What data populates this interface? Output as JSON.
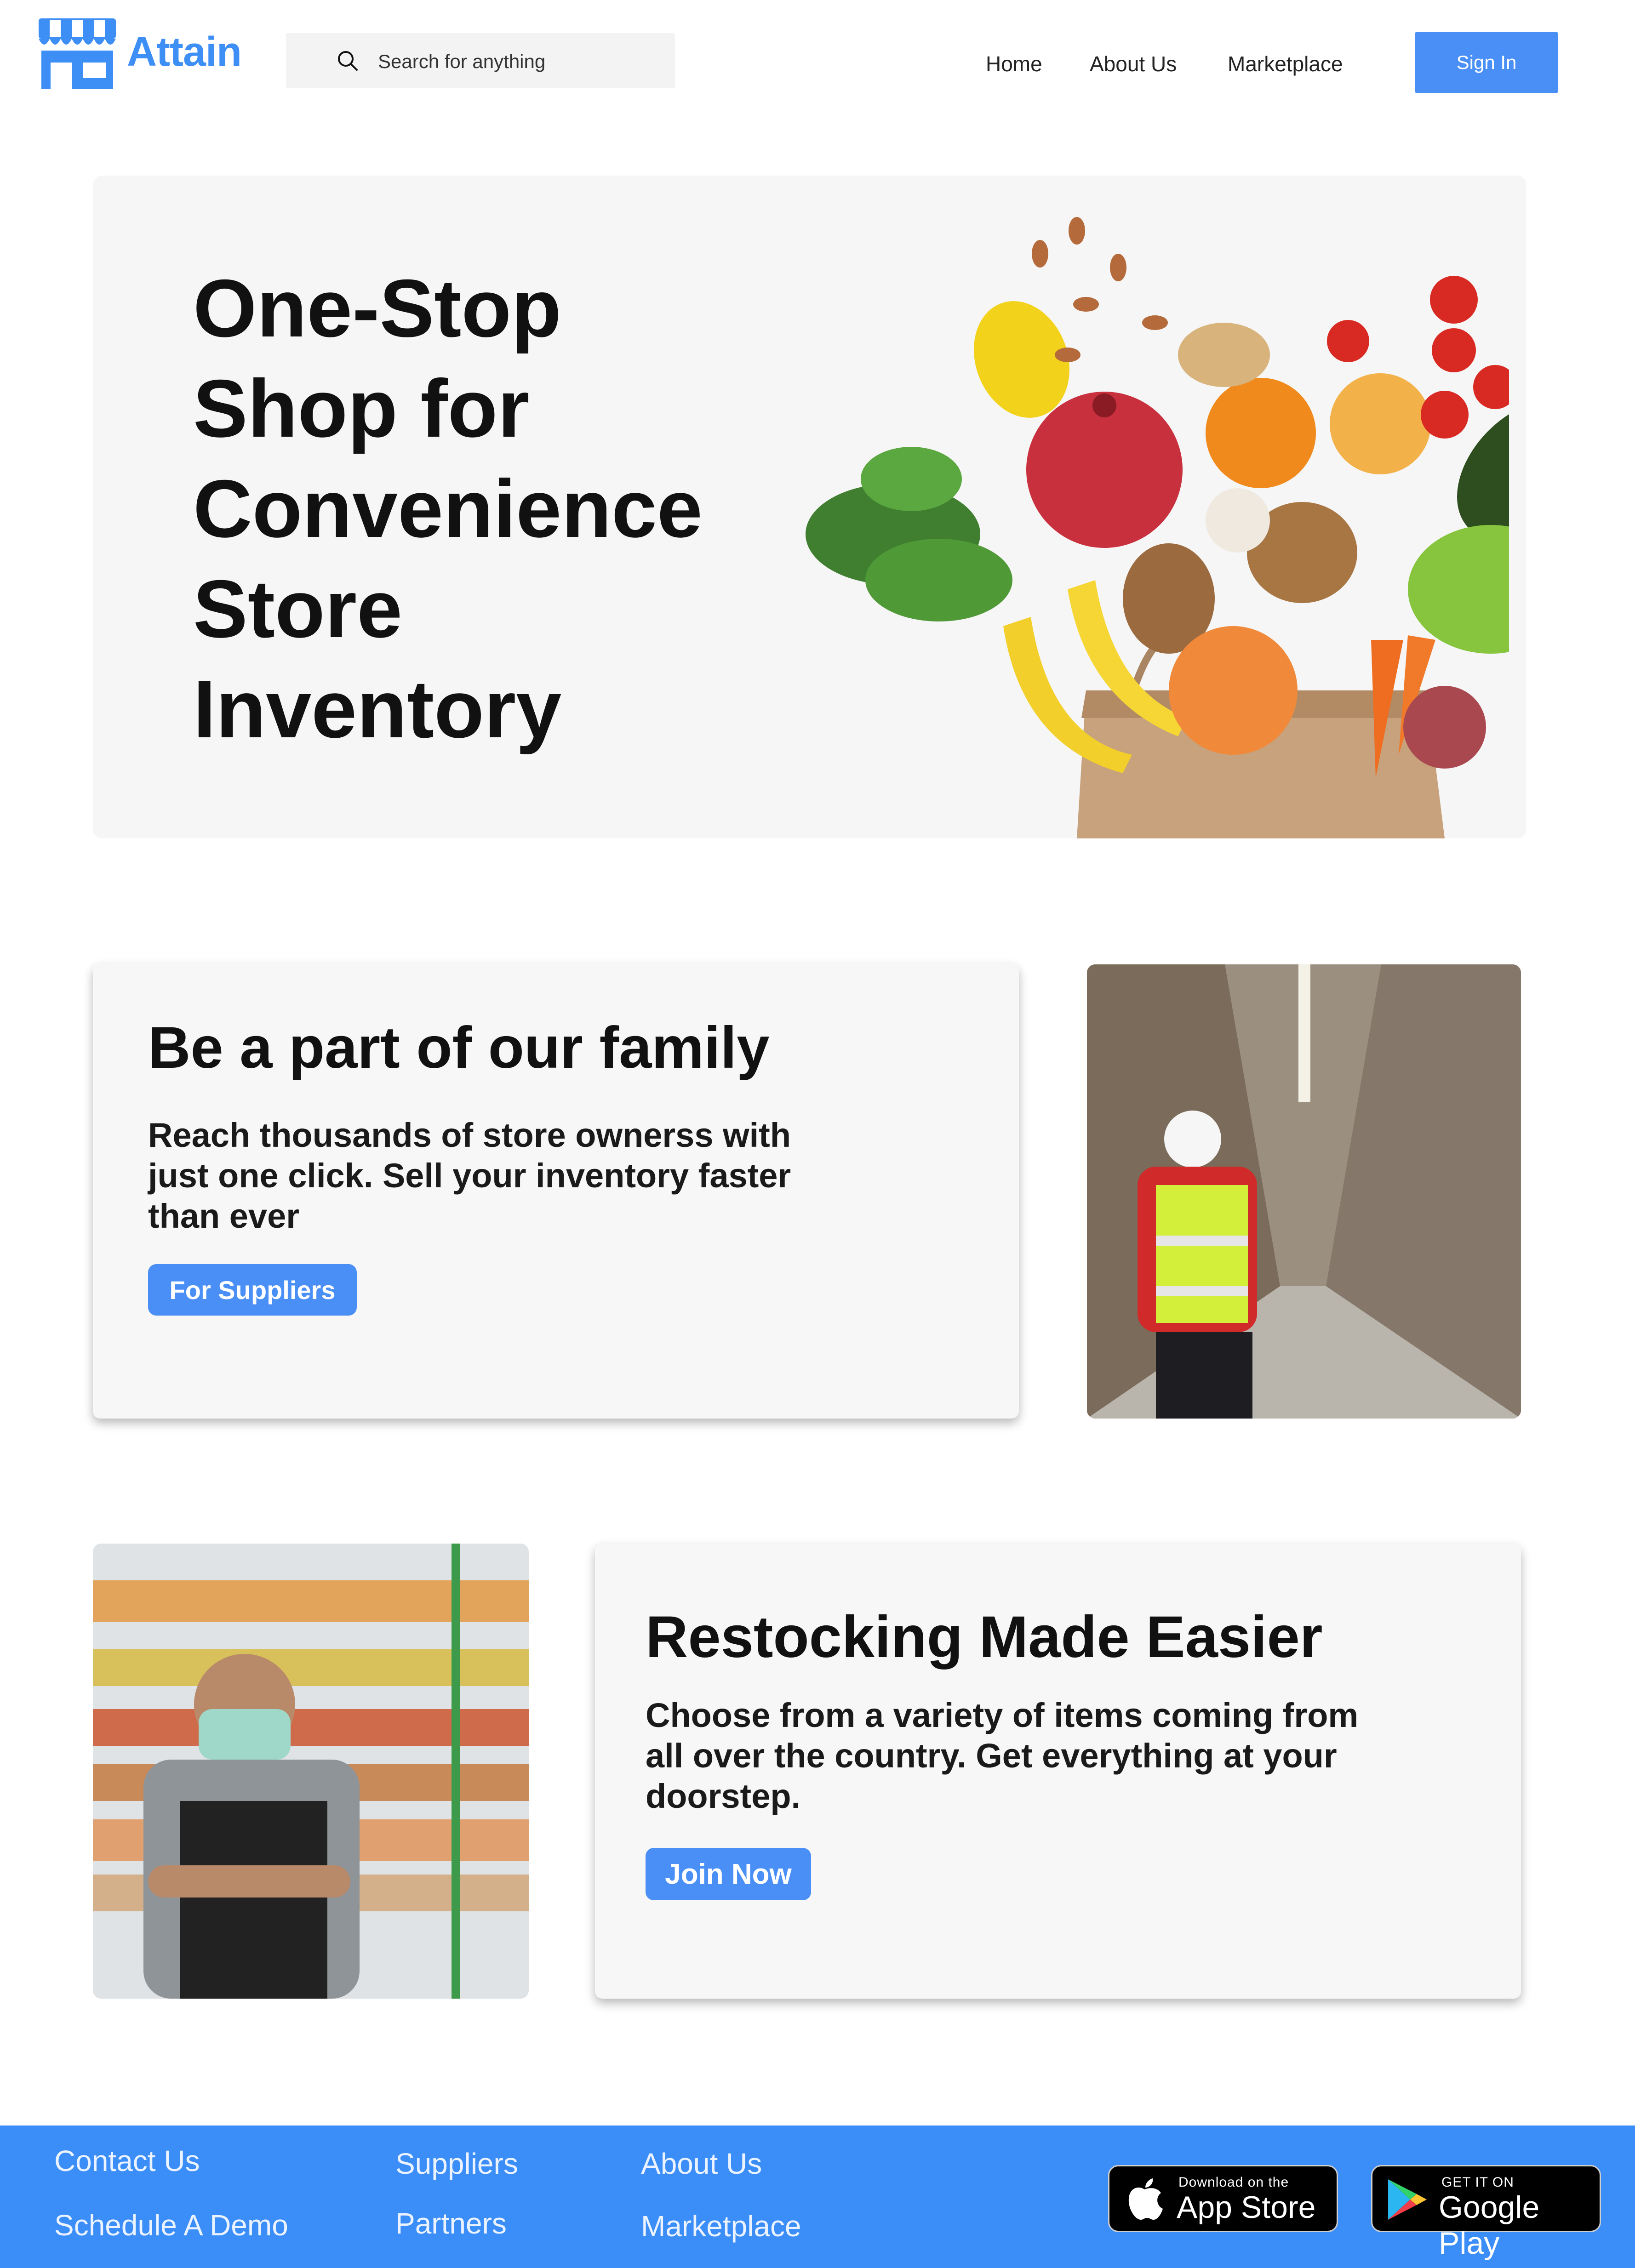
{
  "header": {
    "brand": "Attain",
    "search_placeholder": "Search for anything",
    "nav": [
      "Home",
      "About Us",
      "Marketplace"
    ],
    "sign_in": "Sign In",
    "brand_color": "#3d8ef5"
  },
  "hero": {
    "title_lines": [
      "One-Stop",
      "Shop for",
      "Convenience",
      "Store",
      "Inventory"
    ]
  },
  "suppliers_card": {
    "title": "Be a part of our family",
    "body_lines": [
      "Reach thousands of store ownerss with",
      "just one click. Sell your inventory faster",
      "than ever"
    ],
    "button": "For Suppliers"
  },
  "restock_card": {
    "title": "Restocking Made Easier",
    "body_lines": [
      "Choose from a variety of items coming from",
      "all over the country. Get everything at your",
      "doorstep."
    ],
    "button": "Join Now"
  },
  "footer": {
    "col1": [
      "Contact Us",
      "Schedule A Demo"
    ],
    "col2": [
      "Suppliers",
      "Partners"
    ],
    "col3": [
      "About Us",
      "Marketplace"
    ],
    "app_store": {
      "small": "Download on the",
      "big": "App Store"
    },
    "google_play": {
      "small": "GET IT ON",
      "big": "Google Play"
    },
    "footer_color": "#3b8df7"
  },
  "icons": {
    "logo": "storefront-icon",
    "search": "search-icon",
    "apple": "apple-icon",
    "play": "google-play-icon"
  }
}
